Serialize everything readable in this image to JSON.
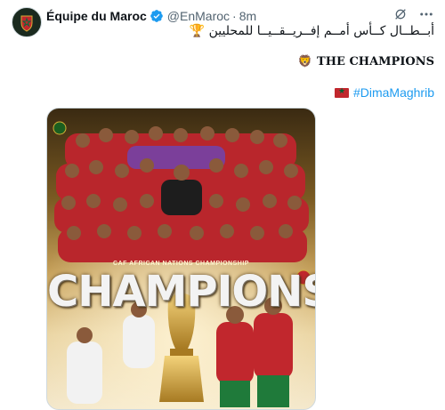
{
  "tweet": {
    "author_name": "Équipe du Maroc",
    "handle": "@EnMaroc",
    "separator": "·",
    "time": "8m",
    "line_arabic": "أبــطــال كــأس أمــم إفــريــقــيــا للمحليين 🏆",
    "line_champions": "THE CHAMPIONS",
    "line_champions_emoji": "🦁",
    "hashtag": "#DimaMaghrib"
  },
  "poster": {
    "subtitle": "CAF AFRICAN NATIONS CHAMPIONSHIP",
    "title": "CHAMPIONS"
  },
  "icons": {
    "avatar": "morocco-federation-crest-icon",
    "verified": "verified-badge-icon",
    "grok": "grok-icon",
    "more": "more-icon",
    "flag": "morocco-flag-icon"
  },
  "colors": {
    "link": "#1d9bf0",
    "text": "#0f1419",
    "muted": "#536471",
    "jersey_red": "#c1272d",
    "gold": "#c7a15a"
  }
}
